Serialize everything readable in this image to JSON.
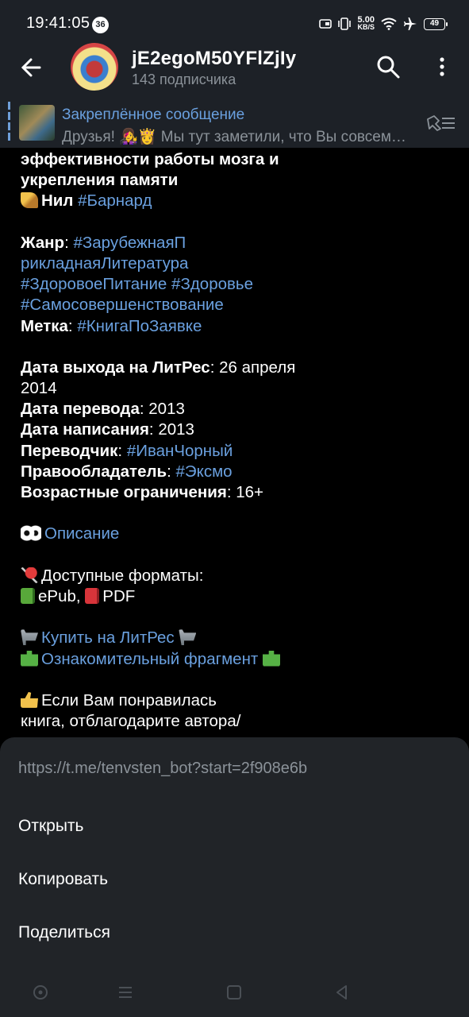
{
  "status_bar": {
    "time": "19:41:05",
    "notification_count": "36",
    "net_speed_value": "5.00",
    "net_speed_unit": "KB/S",
    "battery": "49"
  },
  "header": {
    "title": "jE2egoM50YFlZjIy",
    "subtitle": "143 подписчика"
  },
  "pinned": {
    "title": "Закреплённое сообщение",
    "text": "Друзья! 👩‍🎤👸 Мы тут заметили, что Вы совсем…"
  },
  "message": {
    "title_line1": "эффективности работы мозга и",
    "title_line2": "укрепления памяти",
    "author_prefix": "Нил",
    "author_tag": "#Барнард",
    "genre_label": "Жанр",
    "genre_tag1_part1": "#ЗарубежнаяП",
    "genre_tag1_part2": "рикладнаяЛитература",
    "genre_tag2": "#ЗдоровоеПитание",
    "genre_tag3": "#Здоровье",
    "genre_tag4": "#Самосовершенствование",
    "mark_label": "Метка",
    "mark_tag": "#КнигаПоЗаявке",
    "release_label": "Дата выхода на ЛитРес",
    "release_value_part1": "26 апреля",
    "release_value_part2": "2014",
    "translation_label": "Дата перевода",
    "translation_value": "2013",
    "written_label": "Дата написания",
    "written_value": "2013",
    "translator_label": "Переводчик",
    "translator_tag": "#ИванЧорный",
    "rights_label": "Правообладатель",
    "rights_tag": "#Эксмо",
    "age_label": "Возрастные ограничения",
    "age_value": "16+",
    "description_link": "Описание",
    "formats_label": "Доступные форматы:",
    "format1": "ePub,",
    "format2": "PDF",
    "buy_link": "Купить на ЛитРес",
    "fragment_link": "Ознакомительный фрагмент",
    "thanks_line1": "Если Вам понравилась",
    "thanks_line2": "книга, отблагодарите автора/"
  },
  "sheet": {
    "url": "https://t.me/tenvsten_bot?start=2f908e6b",
    "open": "Открыть",
    "copy": "Копировать",
    "share": "Поделиться"
  }
}
